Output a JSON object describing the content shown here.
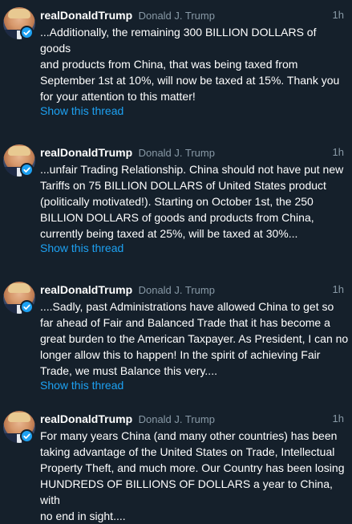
{
  "colors": {
    "background": "#15202b",
    "secondary_text": "#8899a6",
    "link": "#1da1f2",
    "verified_badge": "#1da1f2"
  },
  "tweets": [
    {
      "screen_name": "realDonaldTrump",
      "display_name": "Donald J. Trump",
      "time": "1h",
      "verified_icon": "verified-badge-icon",
      "lines": [
        "...Additionally, the remaining 300 BILLION DOLLARS of goods",
        "and products from China, that was being taxed from",
        "September 1st at 10%, will now be taxed at 15%. Thank you",
        "for your attention to this matter!"
      ],
      "thread_label": "Show this thread"
    },
    {
      "screen_name": "realDonaldTrump",
      "display_name": "Donald J. Trump",
      "time": "1h",
      "verified_icon": "verified-badge-icon",
      "lines": [
        "...unfair Trading Relationship. China should not have put new",
        "Tariffs on 75 BILLION DOLLARS of United States product",
        "(politically motivated!). Starting on October 1st, the 250",
        "BILLION DOLLARS of goods and products from China,",
        "currently being taxed at 25%, will be taxed at 30%..."
      ],
      "thread_label": "Show this thread"
    },
    {
      "screen_name": "realDonaldTrump",
      "display_name": "Donald J. Trump",
      "time": "1h",
      "verified_icon": "verified-badge-icon",
      "lines": [
        "....Sadly, past Administrations have allowed China to get so",
        "far ahead of Fair and Balanced Trade that it has become a",
        "great burden to the American Taxpayer. As President, I can no",
        "longer allow this to happen! In the spirit of achieving Fair",
        "Trade, we must Balance this very...."
      ],
      "thread_label": "Show this thread"
    },
    {
      "screen_name": "realDonaldTrump",
      "display_name": "Donald J. Trump",
      "time": "1h",
      "verified_icon": "verified-badge-icon",
      "lines": [
        "For many years China (and many other countries) has been",
        "taking advantage of the United States on Trade, Intellectual",
        "Property Theft, and much more. Our Country has been losing",
        "HUNDREDS OF BILLIONS OF DOLLARS a year to China, with",
        "no end in sight...."
      ]
    }
  ]
}
